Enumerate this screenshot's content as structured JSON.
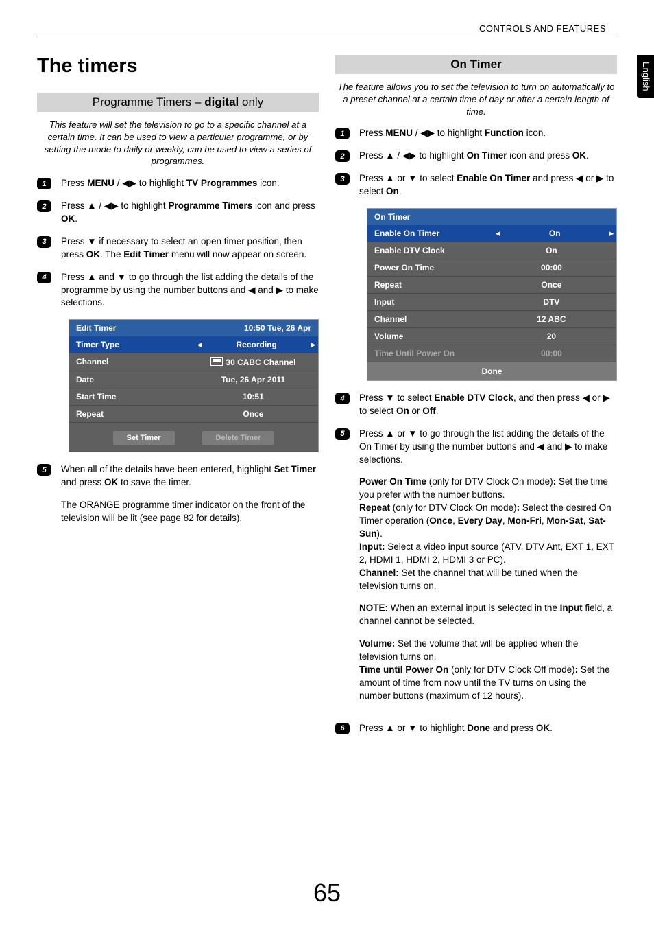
{
  "header": {
    "section": "CONTROLS AND FEATURES",
    "lang": "English",
    "page": "65"
  },
  "left": {
    "h1": "The timers",
    "bar_pre": "Programme Timers – ",
    "bar_bold": "digital",
    "bar_post": " only",
    "intro": "This feature will set the television to go to a specific channel at a certain time. It can be used to view a particular programme, or by setting the mode to daily or weekly, can be used to view a series of programmes.",
    "s1_a": "Press ",
    "s1_menu": "MENU",
    "s1_b": " / ◀▶ to highlight ",
    "s1_tv": "TV Programmes",
    "s1_c": " icon.",
    "s2_a": "Press ▲ / ◀▶ to highlight ",
    "s2_pt": "Programme Timers",
    "s2_b": "  icon and press ",
    "s2_ok": "OK",
    "s2_c": ".",
    "s3_a": "Press ▼ if necessary to select an open timer position, then press ",
    "s3_ok": "OK",
    "s3_b": ". The ",
    "s3_et": "Edit Timer",
    "s3_c": " menu will now appear on screen.",
    "s4": "Press ▲ and ▼ to go through the list adding the details of the programme by using the number buttons and ◀ and ▶ to make selections.",
    "osd": {
      "title": "Edit Timer",
      "clock": "10:50 Tue, 26 Apr",
      "r0l": "Timer Type",
      "r0v": "Recording",
      "r1l": "Channel",
      "r1v": "30 CABC Channel",
      "r2l": "Date",
      "r2v": "Tue, 26 Apr 2011",
      "r3l": "Start Time",
      "r3v": "10:51",
      "r4l": "Repeat",
      "r4v": "Once",
      "b1": "Set Timer",
      "b2": "Delete Timer"
    },
    "s5_a": "When all of the details have been entered, highlight ",
    "s5_st": "Set Timer",
    "s5_b": " and press ",
    "s5_ok": "OK",
    "s5_c": " to save the timer.",
    "s5_p2": "The ORANGE programme timer indicator on the front of the television will be lit (see page 82 for details)."
  },
  "right": {
    "bar": "On Timer",
    "intro": "The feature allows you to set the television to turn on automatically to a preset channel at a certain time of day or after a certain length of time.",
    "s1_a": "Press ",
    "s1_menu": "MENU",
    "s1_b": " / ◀▶ to highlight ",
    "s1_fn": "Function",
    "s1_c": " icon.",
    "s2_a": "Press ▲ / ◀▶ to highlight ",
    "s2_ot": "On Timer",
    "s2_b": " icon and press ",
    "s2_ok": "OK",
    "s2_c": ".",
    "s3_a": "Press ▲ or ▼ to select ",
    "s3_eot": "Enable On Timer",
    "s3_b": " and press ◀ or ▶ to select ",
    "s3_on": "On",
    "s3_c": ".",
    "osd": {
      "title": "On Timer",
      "r0l": "Enable On Timer",
      "r0v": "On",
      "r1l": "Enable DTV Clock",
      "r1v": "On",
      "r2l": "Power On Time",
      "r2v": "00:00",
      "r3l": "Repeat",
      "r3v": "Once",
      "r4l": "Input",
      "r4v": "DTV",
      "r5l": "Channel",
      "r5v": "12 ABC",
      "r6l": "Volume",
      "r6v": "20",
      "r7l": "Time Until Power On",
      "r7v": "00:00",
      "done": "Done"
    },
    "s4_a": "Press ▼ to select ",
    "s4_edc": "Enable DTV Clock",
    "s4_b": ", and then press ◀ or ▶ to select ",
    "s4_on": "On",
    "s4_or": " or ",
    "s4_off": "Off",
    "s4_c": ".",
    "s5": "Press ▲ or ▼ to go through the list adding the details of the On Timer by using the number buttons and ◀ and ▶ to make selections.",
    "d_pot_l": "Power On Time",
    "d_pot_t1": " (only for DTV Clock On mode)",
    "d_pot_c": ": ",
    "d_pot_t2": "Set the time you prefer with the number buttons.",
    "d_rep_l": "Repeat",
    "d_rep_t1": " (only for DTV Clock On mode)",
    "d_rep_c": ": ",
    "d_rep_t2": "Select the desired On Timer operation (",
    "d_rep_o1": "Once",
    "d_rep_s": ", ",
    "d_rep_o2": "Every Day",
    "d_rep_o3": "Mon-Fri",
    "d_rep_o4": "Mon-Sat",
    "d_rep_o5": "Sat-Sun",
    "d_rep_e": ").",
    "d_inp_l": "Input:",
    "d_inp_t": " Select a video input source (ATV, DTV Ant, EXT 1, EXT 2, HDMI 1, HDMI 2, HDMI 3 or PC).",
    "d_ch_l": "Channel:",
    "d_ch_t": " Set the channel that will be tuned when the television turns on.",
    "d_note_l": "NOTE:",
    "d_note_t1": " When an external input is selected in the ",
    "d_note_b": "Input",
    "d_note_t2": " field, a channel cannot be selected.",
    "d_vol_l": "Volume:",
    "d_vol_t": " Set the volume that will be applied when the television turns on.",
    "d_tup_l": "Time until Power On",
    "d_tup_t1": " (only for DTV Clock Off mode)",
    "d_tup_c": ": ",
    "d_tup_t2": "Set the amount of time from now until the TV turns on using the number buttons (maximum of 12 hours).",
    "s6_a": "Press ▲ or ▼ to highlight ",
    "s6_d": "Done",
    "s6_b": " and press ",
    "s6_ok": "OK",
    "s6_c": "."
  }
}
